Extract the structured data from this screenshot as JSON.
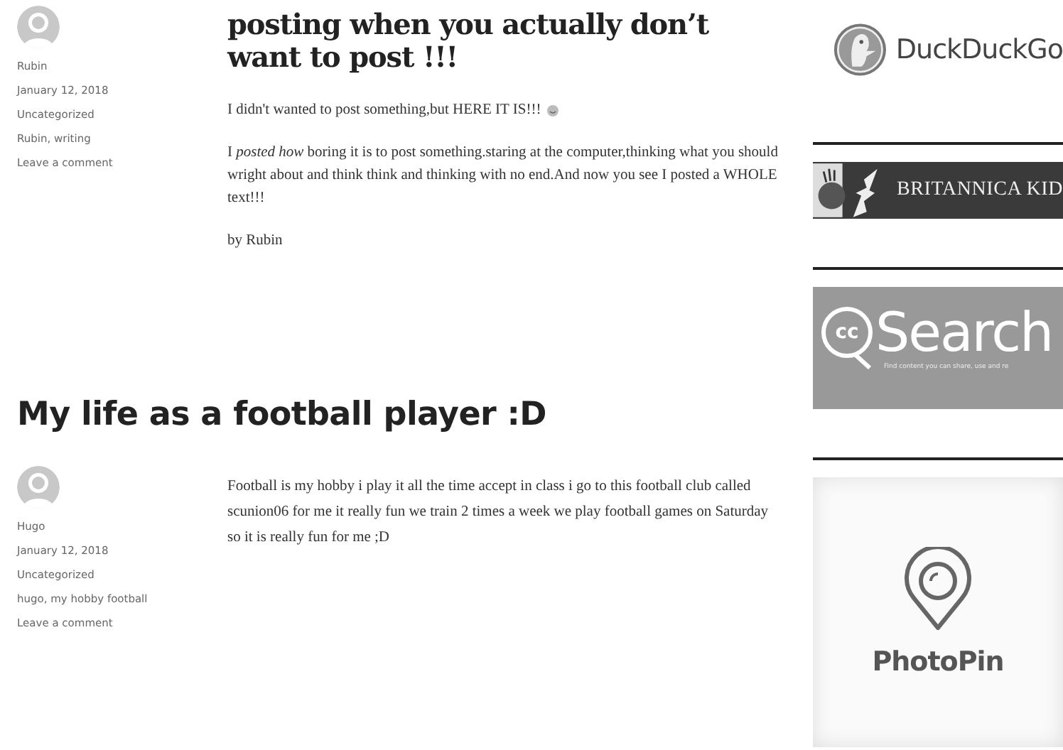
{
  "posts": [
    {
      "kind": "title-in-column",
      "title": "posting when you actually don’t want to post !!!",
      "meta": {
        "author": "Rubin",
        "date": "January 12, 2018",
        "category": "Uncategorized",
        "tags": "Rubin, writing",
        "comments": "Leave a comment"
      },
      "paragraphs": [
        {
          "text": "I didn't wanted to post something,but  HERE IT IS!!!",
          "emoji": true
        },
        {
          "text": "I *posted how* boring it is to post something.staring at the computer,thinking what you should wright about and think think and thinking with no end.And now you see  I posted a WHOLE text!!!",
          "emoji": false
        },
        {
          "text": "by Rubin",
          "emoji": false
        }
      ]
    },
    {
      "kind": "title-above",
      "title": "My life as a football player :D",
      "meta": {
        "author": "Hugo",
        "date": "January 12, 2018",
        "category": "Uncategorized",
        "tags": "hugo, my hobby football",
        "comments": "Leave a comment"
      },
      "paragraphs": [
        {
          "text": "Football is my hobby i play it all the time accept in class i go to this football club called scunion06 for me it really fun we train 2 times a week we play football games on Saturday so it is really fun for me ;D",
          "emoji": false
        }
      ]
    }
  ],
  "sidebar": [
    {
      "kind": "duckduckgo",
      "name": "DuckDuckGo"
    },
    {
      "kind": "britannica",
      "name": "BRITANNICA KID"
    },
    {
      "kind": "ccsearch",
      "badge": "cc",
      "name": "Search",
      "tagline": "Find content you can share, use and re"
    },
    {
      "kind": "photopin",
      "name": "PhotoPin"
    }
  ]
}
